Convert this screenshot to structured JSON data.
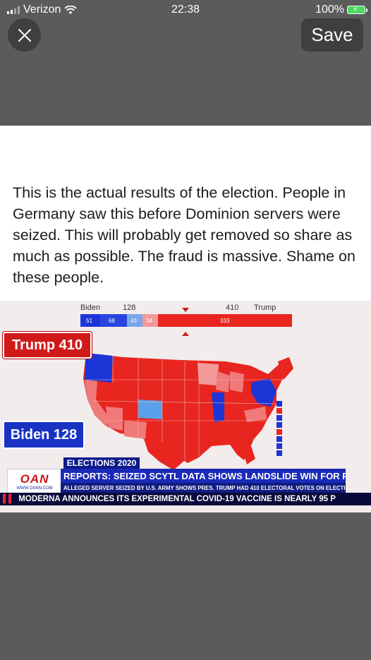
{
  "status": {
    "carrier": "Verizon",
    "time": "22:38",
    "battery": "100%"
  },
  "toolbar": {
    "close_label": "X",
    "save_label": "Save"
  },
  "post": {
    "text": "This is the actual results of the election. People in Germany saw this before Dominion servers were seized. This will probably get removed so share as much as possible. The fraud is massive. Shame on these people."
  },
  "broadcast": {
    "trump_label": "Trump 410",
    "biden_label": "Biden 128",
    "top_bar": {
      "biden_name": "Biden",
      "biden_total": "128",
      "trump_total": "410",
      "trump_name": "Trump",
      "seg_biden_1": "51",
      "seg_biden_2": "68",
      "seg_mid_1": "43",
      "seg_mid_2": "34",
      "seg_trump": "333"
    },
    "tag": "ELECTIONS 2020",
    "logo": "OAN",
    "logo_url": "WWW.OANN.COM",
    "headline": "REPORTS: SEIZED SCYTL DATA SHOWS LANDSLIDE WIN FOR PRES. TRUMP",
    "subhead": "ALLEGED SERVER SEIZED BY U.S. ARMY SHOWS PRES. TRUMP HAD 410 ELECTORAL VOTES ON ELECTION NIGHT",
    "crawl": "MODERNA ANNOUNCES ITS EXPERIMENTAL COVID-19 VACCINE IS NEARLY 95 P",
    "colors": {
      "red": "#e8261f",
      "light_red": "#f07a7a",
      "blue": "#1b35d6",
      "light_blue": "#5aa0ea"
    }
  }
}
